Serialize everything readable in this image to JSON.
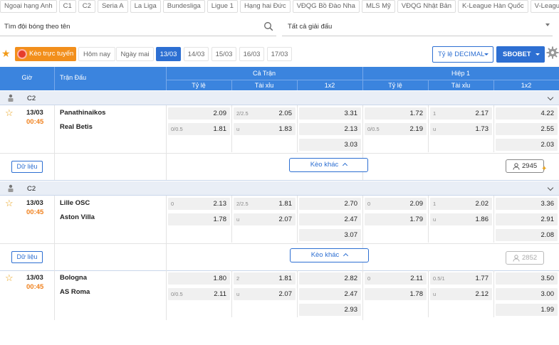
{
  "league_tabs": [
    "Ngoại hạng Anh",
    "C1",
    "C2",
    "Seria A",
    "La Liga",
    "Bundesliga",
    "Ligue 1",
    "Hạng hai Đức",
    "VĐQG Bồ Đào Nha",
    "MLS Mỹ",
    "VĐQG Nhật Bản",
    "K-League Hàn Quốc",
    "V-League"
  ],
  "search": {
    "label": "Tìm đội bóng theo tên"
  },
  "tournament_select": {
    "value": "Tất cả giải đấu"
  },
  "date_filters": {
    "live_label": "Kèo trực tuyến",
    "days": [
      "Hôm nay",
      "Ngày mai",
      "13/03",
      "14/03",
      "15/03",
      "16/03",
      "17/03"
    ],
    "active_index": 2
  },
  "odds_format": "Tỷ lệ DECIMAL",
  "bookmaker": "SBOBET",
  "table_header": {
    "time": "Giờ",
    "match": "Trận Đấu",
    "full_match": "Cả Trận",
    "half1": "Hiệp 1",
    "handicap": "Tỷ lệ",
    "over_under": "Tài xỉu",
    "one_x_two": "1x2"
  },
  "colors": {
    "accent": "#2d6fd2",
    "header_bg": "#3b84de",
    "live": "#f28f1c",
    "time": "#f0821f",
    "star": "#e9a21a"
  },
  "more_label": "Kèo khác",
  "data_label": "Dữ liệu",
  "matches": [
    {
      "league": "C2",
      "date": "13/03",
      "time": "00:45",
      "home": "Panathinaikos",
      "away": "Real Betis",
      "ft_hdp": [
        {
          "h": "",
          "v": "2.09"
        },
        {
          "h": "0/0.5",
          "v": "1.81"
        }
      ],
      "ft_ou": [
        {
          "h": "2/2.5",
          "v": "2.05"
        },
        {
          "h": "u",
          "v": "1.83"
        }
      ],
      "ft_1x2": [
        "3.31",
        "2.13",
        "3.03"
      ],
      "h1_hdp": [
        {
          "h": "",
          "v": "1.72"
        },
        {
          "h": "0/0.5",
          "v": "2.19"
        }
      ],
      "h1_ou": [
        {
          "h": "1",
          "v": "2.17"
        },
        {
          "h": "u",
          "v": "1.73"
        }
      ],
      "h1_1x2": [
        "4.22",
        "2.55",
        "2.03"
      ],
      "count": "2945",
      "count_dim": false
    },
    {
      "league": "C2",
      "date": "13/03",
      "time": "00:45",
      "home": "Lille OSC",
      "away": "Aston Villa",
      "ft_hdp": [
        {
          "h": "0",
          "v": "2.13"
        },
        {
          "h": "",
          "v": "1.78"
        }
      ],
      "ft_ou": [
        {
          "h": "2/2.5",
          "v": "1.81"
        },
        {
          "h": "u",
          "v": "2.07"
        }
      ],
      "ft_1x2": [
        "2.70",
        "2.47",
        "3.07"
      ],
      "h1_hdp": [
        {
          "h": "0",
          "v": "2.09"
        },
        {
          "h": "",
          "v": "1.79"
        }
      ],
      "h1_ou": [
        {
          "h": "1",
          "v": "2.02"
        },
        {
          "h": "u",
          "v": "1.86"
        }
      ],
      "h1_1x2": [
        "3.36",
        "2.91",
        "2.08"
      ],
      "count": "2852",
      "count_dim": true
    },
    {
      "date": "13/03",
      "time": "00:45",
      "home": "Bologna",
      "away": "AS Roma",
      "ft_hdp": [
        {
          "h": "",
          "v": "1.80"
        },
        {
          "h": "0/0.5",
          "v": "2.11"
        }
      ],
      "ft_ou": [
        {
          "h": "2",
          "v": "1.81"
        },
        {
          "h": "u",
          "v": "2.07"
        }
      ],
      "ft_1x2": [
        "2.82",
        "2.47",
        "2.93"
      ],
      "h1_hdp": [
        {
          "h": "0",
          "v": "2.11"
        },
        {
          "h": "",
          "v": "1.78"
        }
      ],
      "h1_ou": [
        {
          "h": "0.5/1",
          "v": "1.77"
        },
        {
          "h": "u",
          "v": "2.12"
        }
      ],
      "h1_1x2": [
        "3.50",
        "3.00",
        "1.99"
      ]
    }
  ]
}
